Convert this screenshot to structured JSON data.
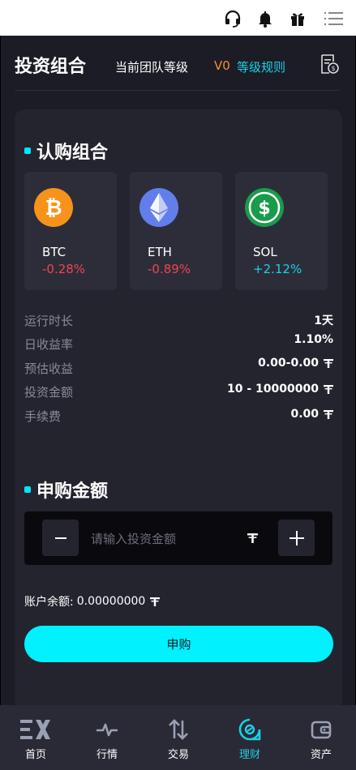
{
  "header": {
    "title": "投资组合",
    "team_level_label": "当前团队等级",
    "level": "V0",
    "level_rules": "等级规则"
  },
  "icons": [
    "headset-icon",
    "bell-icon",
    "gift-icon",
    "menu-icon",
    "document-icon"
  ],
  "portfolio": {
    "title": "认购组合",
    "coins": [
      {
        "symbol": "BTC",
        "change": "-0.28%",
        "color": "#f7931a",
        "trend": "down"
      },
      {
        "symbol": "ETH",
        "change": "-0.89%",
        "color": "#627eea",
        "trend": "down"
      },
      {
        "symbol": "SOL",
        "change": "+2.12%",
        "color": "#1a9b4b",
        "trend": "up"
      }
    ],
    "details": [
      {
        "label": "运行时长",
        "value": "1天",
        "unit": false
      },
      {
        "label": "日收益率",
        "value": "1.10%",
        "unit": false
      },
      {
        "label": "预估收益",
        "value": "0.00-0.00",
        "unit": true
      },
      {
        "label": "投资金额",
        "value": "10 - 10000000",
        "unit": true
      },
      {
        "label": "手续费",
        "value": "0.00",
        "unit": true
      }
    ]
  },
  "subscribe": {
    "title": "申购金额",
    "input_placeholder": "请输入投资金额",
    "decrement": "−",
    "increment": "+",
    "balance_label": "账户余额:",
    "balance_value": "0.00000000",
    "submit_label": "申购"
  },
  "tabbar": {
    "items": [
      {
        "label": "首页",
        "icon": "ex-logo-icon"
      },
      {
        "label": "行情",
        "icon": "pulse-icon"
      },
      {
        "label": "交易",
        "icon": "swap-arrows-icon"
      },
      {
        "label": "理财",
        "icon": "finance-icon",
        "active": true
      },
      {
        "label": "资产",
        "icon": "wallet-icon"
      }
    ]
  },
  "colors": {
    "accent": "#00f1ff",
    "up": "#1ad0e6",
    "down": "#f0444e",
    "level": "#f58f2c"
  }
}
